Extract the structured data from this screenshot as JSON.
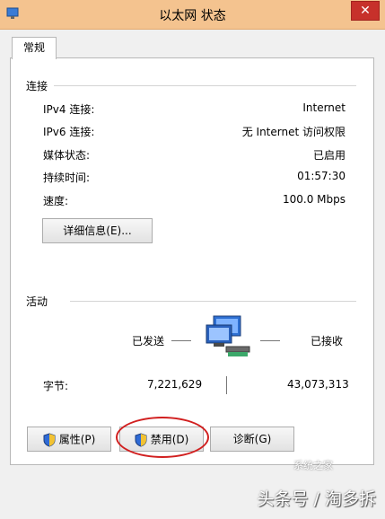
{
  "window": {
    "title": "以太网 状态",
    "close_glyph": "✕"
  },
  "tabs": [
    {
      "label": "常规"
    }
  ],
  "connection": {
    "group_title": "连接",
    "rows": [
      {
        "label": "IPv4 连接:",
        "value": "Internet"
      },
      {
        "label": "IPv6 连接:",
        "value": "无 Internet 访问权限"
      },
      {
        "label": "媒体状态:",
        "value": "已启用"
      },
      {
        "label": "持续时间:",
        "value": "01:57:30"
      },
      {
        "label": "速度:",
        "value": "100.0 Mbps"
      }
    ],
    "details_button": "详细信息(E)..."
  },
  "activity": {
    "group_title": "活动",
    "sent_label": "已发送",
    "received_label": "已接收",
    "bytes_label": "字节:",
    "bytes_sent": "7,221,629",
    "bytes_received": "43,073,313"
  },
  "buttons": {
    "properties": "属性(P)",
    "disable": "禁用(D)",
    "diagnose": "诊断(G)"
  },
  "watermark": {
    "text": "头条号 / 淘多拆",
    "badge": "系统之家"
  },
  "colors": {
    "titlebar": "#f4c38f",
    "close": "#c7312b",
    "annotation": "#d11f1f"
  }
}
